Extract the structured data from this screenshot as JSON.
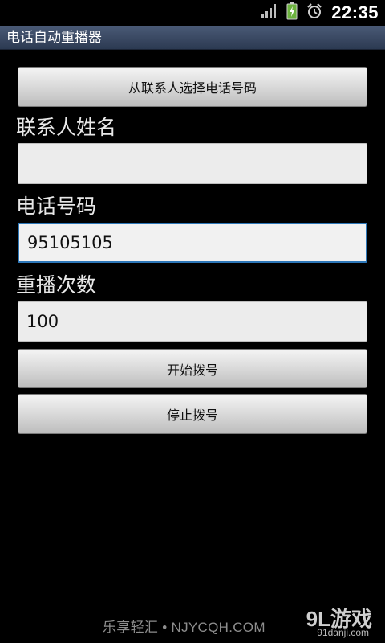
{
  "status_bar": {
    "time": "22:35",
    "icons": [
      "signal-icon",
      "battery-icon",
      "alarm-icon"
    ]
  },
  "app": {
    "title": "电话自动重播器"
  },
  "form": {
    "select_contact_label": "从联系人选择电话号码",
    "contact_name_label": "联系人姓名",
    "contact_name_value": "",
    "phone_label": "电话号码",
    "phone_value": "95105105",
    "redial_label": "重播次数",
    "redial_value": "100",
    "start_label": "开始拨号",
    "stop_label": "停止拨号"
  },
  "footer": {
    "watermark": "乐享轻汇 • NJYCQH.COM",
    "logo_brand": "9L游戏",
    "logo_domain": "91danji.com"
  },
  "colors": {
    "background": "#000000",
    "title_bar": "#34435e",
    "button": "#d6d6d6",
    "field": "#ececec",
    "focus_border": "#2d77b8"
  }
}
